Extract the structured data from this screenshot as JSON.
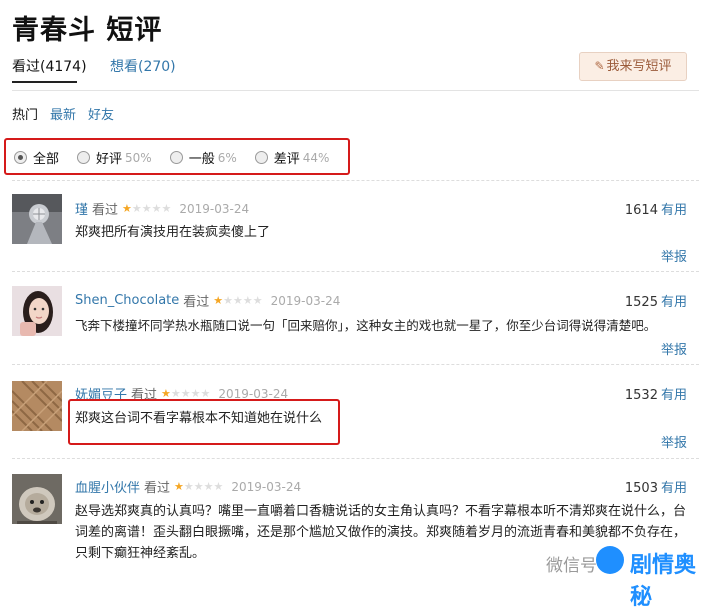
{
  "header": {
    "title": "青春斗 短评"
  },
  "tabs": [
    {
      "label": "看过(4174)",
      "active": true
    },
    {
      "label": "想看(270)",
      "active": false
    }
  ],
  "write_button": {
    "label": "我来写短评",
    "icon": "pencil-icon"
  },
  "sort": [
    "热门",
    "最新",
    "好友"
  ],
  "filter": [
    {
      "label": "全部",
      "pct": "",
      "checked": true
    },
    {
      "label": "好评",
      "pct": "50%",
      "checked": false
    },
    {
      "label": "一般",
      "pct": "6%",
      "checked": false
    },
    {
      "label": "差评",
      "pct": "44%",
      "checked": false
    }
  ],
  "reviews": [
    {
      "user": "瑾",
      "seen": "看过",
      "rating": 1,
      "date": "2019-03-24",
      "votes": "1614",
      "useful": "有用",
      "text": "郑爽把所有演技用在装疯卖傻上了",
      "report": "举报"
    },
    {
      "user": "Shen_Chocolate",
      "seen": "看过",
      "rating": 1,
      "date": "2019-03-24",
      "votes": "1525",
      "useful": "有用",
      "text": "飞奔下楼撞坏同学热水瓶随口说一句「回来赔你」，这种女主的戏也就一星了，你至少台词得说得清楚吧。",
      "report": "举报"
    },
    {
      "user": "妩媚豆子",
      "seen": "看过",
      "rating": 1,
      "date": "2019-03-24",
      "votes": "1532",
      "useful": "有用",
      "text": "郑爽这台词不看字幕根本不知道她在说什么",
      "report": "举报"
    },
    {
      "user": "血腥小伙伴",
      "seen": "看过",
      "rating": 1,
      "date": "2019-03-24",
      "votes": "1503",
      "useful": "有用",
      "text": "赵导选郑爽真的认真吗？嘴里一直嚼着口香糖说话的女主角认真吗？不看字幕根本听不清郑爽在说什么，台词差的离谱！歪头翻白眼撅嘴，还是那个尴尬又做作的演技。郑爽随着岁月的流逝青春和美貌都不负存在，只剩下癫狂神经紊乱。",
      "report": ""
    }
  ],
  "watermark": {
    "prefix": "微信号",
    "brand": "剧情奥秘"
  }
}
